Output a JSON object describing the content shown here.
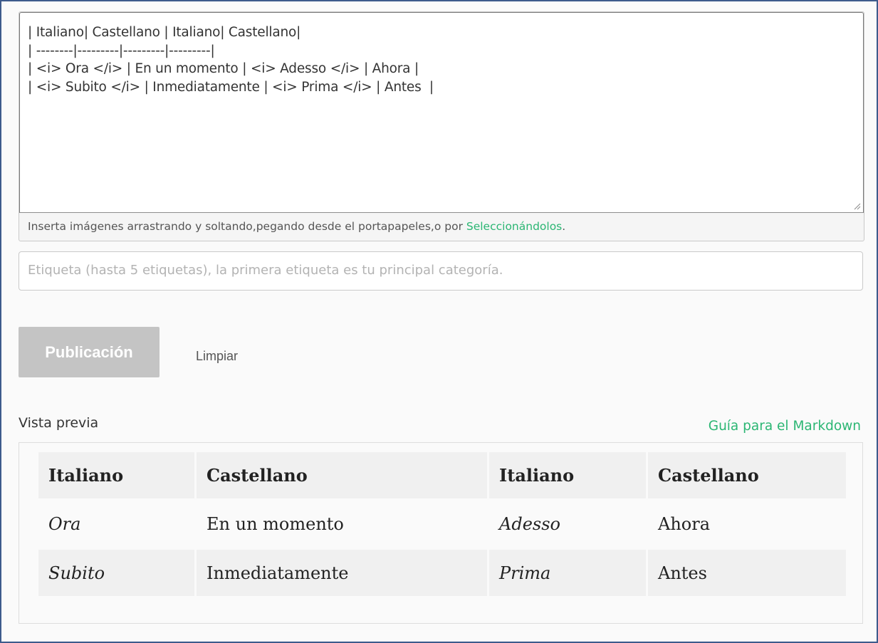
{
  "editor": {
    "content": "| Italiano| Castellano | Italiano| Castellano|\n| --------|---------|---------|---------|\n| <i> Ora </i> | En un momento | <i> Adesso </i> | Ahora |\n| <i> Subito </i> | Inmediatamente | <i> Prima </i> | Antes  |",
    "dropzone_text": "Inserta imágenes arrastrando y soltando,pegando desde el portapapeles,o por ",
    "dropzone_link": "Seleccionándolos",
    "dropzone_suffix": "."
  },
  "tags": {
    "placeholder": "Etiqueta (hasta 5 etiquetas), la primera etiqueta es tu principal categoría."
  },
  "actions": {
    "publish_label": "Publicación",
    "clear_label": "Limpiar"
  },
  "preview": {
    "title": "Vista previa",
    "markdown_guide": "Guía para el Markdown",
    "table": {
      "headers": [
        "Italiano",
        "Castellano",
        "Italiano",
        "Castellano"
      ],
      "rows": [
        [
          "Ora",
          "En un momento",
          "Adesso",
          "Ahora"
        ],
        [
          "Subito",
          "Inmediatamente",
          "Prima",
          "Antes"
        ]
      ]
    }
  },
  "colors": {
    "accent": "#2bb673",
    "disabled_button": "#c4c4c4",
    "frame_border": "#3d5b8c"
  }
}
